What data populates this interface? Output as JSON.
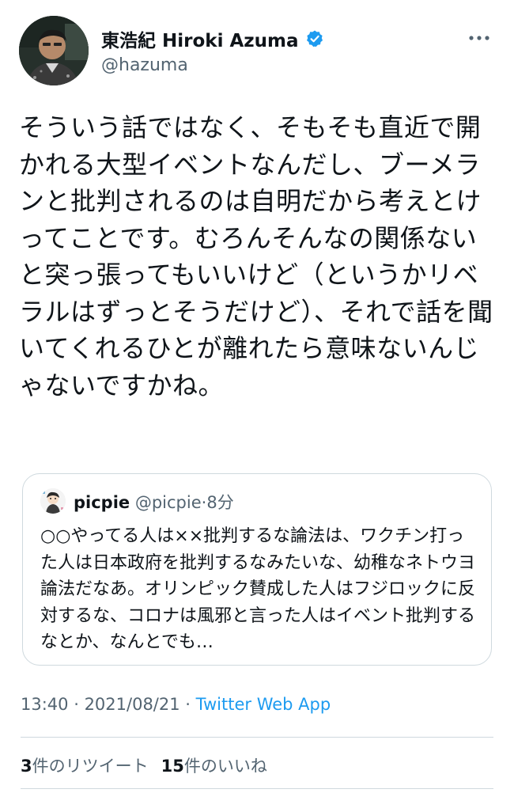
{
  "author": {
    "display_name": "東浩紀 Hiroki Azuma",
    "handle": "@hazuma",
    "avatar_icon": "user-avatar-photo",
    "verified_icon": "verified-badge-icon",
    "menu_icon": "more-dots-icon"
  },
  "tweet": {
    "text": "そういう話ではなく、そもそも直近で開かれる大型イベントなんだし、ブーメランと批判されるのは自明だから考えとけってことです。むろんそんなの関係ないと突っ張ってもいいけど（というかリベラルはずっとそうだけど）、それで話を聞いてくれるひとが離れたら意味ないんじゃないですかね。"
  },
  "quote": {
    "display_name": "picpie",
    "handle": "@picpie",
    "separator": "·",
    "time": "8分",
    "avatar_icon": "user-avatar-illustration",
    "text": "○○やってる人は××批判するな論法は、ワクチン打った人は日本政府を批判するなみたいな、幼稚なネトウヨ論法だなあ。オリンピック賛成した人はフジロックに反対するな、コロナは風邪と言った人はイベント批判するなとか、なんとでも…"
  },
  "meta": {
    "time": "13:40",
    "separator1": " · ",
    "date": "2021/08/21",
    "separator2": " · ",
    "source": "Twitter Web App"
  },
  "stats": {
    "retweets_count": "3",
    "retweets_label": "件のリツイート",
    "likes_count": "15",
    "likes_label": "件のいいね"
  },
  "colors": {
    "accent": "#1d9bf0",
    "secondary_text": "#536471",
    "border": "#cfd9de",
    "primary_text": "#0f1419"
  }
}
